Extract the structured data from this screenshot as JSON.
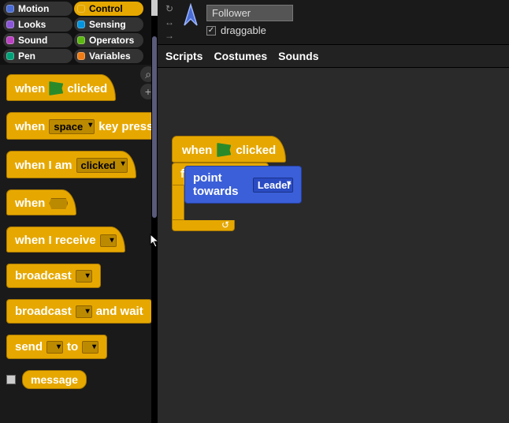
{
  "categories": [
    {
      "name": "Motion",
      "color": "#4a6cd4",
      "active": false
    },
    {
      "name": "Control",
      "color": "#e6a800",
      "active": true
    },
    {
      "name": "Looks",
      "color": "#8a55d7",
      "active": false
    },
    {
      "name": "Sensing",
      "color": "#0494dc",
      "active": false
    },
    {
      "name": "Sound",
      "color": "#bb42c3",
      "active": false
    },
    {
      "name": "Operators",
      "color": "#5cb712",
      "active": false
    },
    {
      "name": "Pen",
      "color": "#00a178",
      "active": false
    },
    {
      "name": "Variables",
      "color": "#ee7d16",
      "active": false
    }
  ],
  "palette": {
    "when_flag_1": "when",
    "when_flag_2": "clicked",
    "when_key_1": "when",
    "when_key_dd": "space",
    "when_key_2": "key pressed",
    "when_iam_1": "when I am",
    "when_iam_dd": "clicked",
    "when_cond": "when",
    "when_recv": "when I receive",
    "broadcast": "broadcast",
    "broadcast_wait_1": "broadcast",
    "broadcast_wait_2": "and wait",
    "send_1": "send",
    "send_2": "to",
    "message": "message"
  },
  "sprite": {
    "name": "Follower",
    "draggable_label": "draggable",
    "draggable": true
  },
  "tabs": {
    "scripts": "Scripts",
    "costumes": "Costumes",
    "sounds": "Sounds"
  },
  "script": {
    "hat_1": "when",
    "hat_2": "clicked",
    "forever": "forever",
    "point": "point towards",
    "point_dd": "Leader"
  }
}
